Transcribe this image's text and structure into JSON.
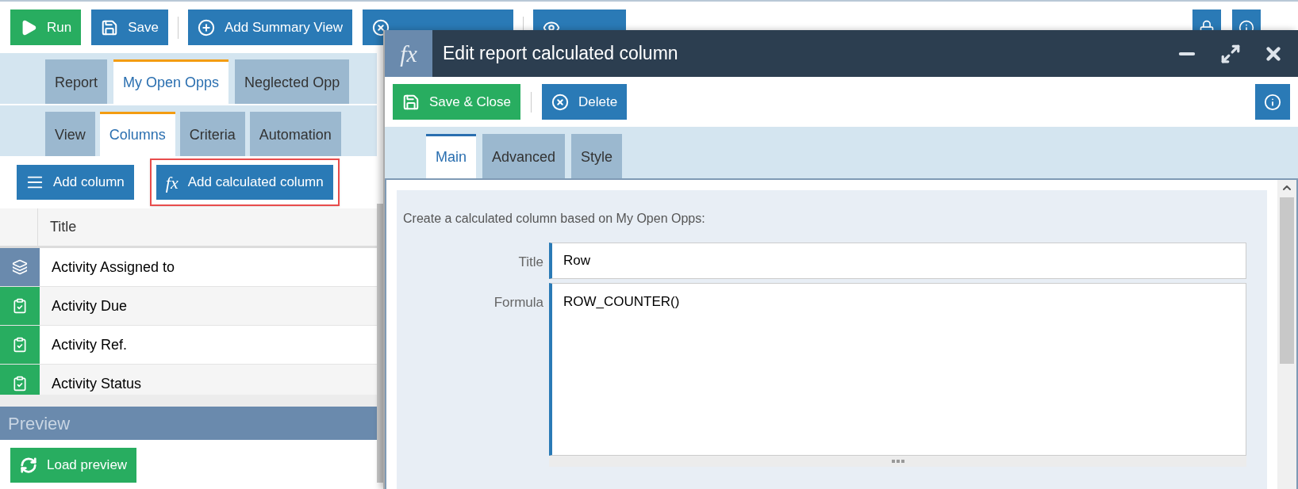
{
  "toolbar": {
    "groups": [
      [
        {
          "label": "Run",
          "kind": "run"
        },
        {
          "label": "Save",
          "kind": "save"
        }
      ],
      [
        {
          "label": "Add Summary View",
          "kind": "add"
        },
        {
          "kind": "remove"
        }
      ],
      [
        {
          "kind": "watch"
        }
      ]
    ],
    "icon_buttons": [
      {
        "kind": "lock"
      },
      {
        "kind": "info"
      }
    ]
  },
  "report_tabs": [
    {
      "label": "Report",
      "selected": false
    },
    {
      "label": "My Open Opps",
      "selected": true
    },
    {
      "label": "Neglected Opp",
      "selected": false
    }
  ],
  "section_tabs": [
    {
      "label": "View",
      "selected": false
    },
    {
      "label": "Columns",
      "selected": true
    },
    {
      "label": "Criteria",
      "selected": false
    },
    {
      "label": "Automation",
      "selected": false
    }
  ],
  "column_buttons": [
    {
      "label": "Add column",
      "kind": "list",
      "highlighted": false
    },
    {
      "label": "Add calculated column",
      "kind": "formula",
      "icon_text": "fx",
      "highlighted": true
    }
  ],
  "table": {
    "columns": [
      "Title"
    ],
    "rows": [
      {
        "title": "Activity Assigned to",
        "kind": "stack"
      },
      {
        "title": "Activity Due",
        "kind": "task"
      },
      {
        "title": "Activity Ref.",
        "kind": "task"
      },
      {
        "title": "Activity Status",
        "kind": "task"
      }
    ]
  },
  "preview": {
    "title": "Preview",
    "button": "Load preview"
  },
  "dialog": {
    "icon_text": "fx",
    "title": "Edit report calculated column",
    "buttons": [
      {
        "label": "Save & Close",
        "kind": "save"
      },
      {
        "label": "Delete",
        "kind": "delete"
      }
    ],
    "tabs": [
      {
        "label": "Main",
        "selected": true
      },
      {
        "label": "Advanced",
        "selected": false
      },
      {
        "label": "Style",
        "selected": false
      }
    ],
    "intro": "Create a calculated column based on My Open Opps:",
    "fields": [
      {
        "label": "Title",
        "value": "Row",
        "kind": "input"
      },
      {
        "label": "Formula",
        "value": "ROW_COUNTER()",
        "kind": "textarea"
      }
    ]
  }
}
